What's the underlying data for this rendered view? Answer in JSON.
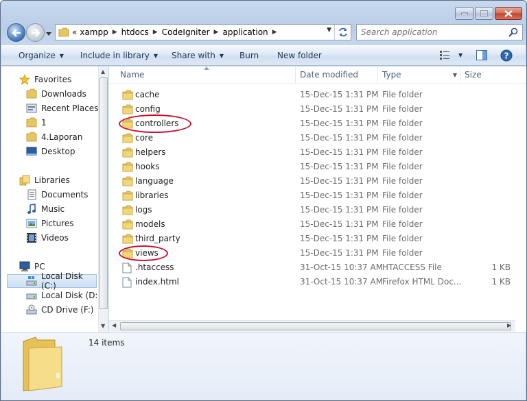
{
  "window": {
    "title": "application"
  },
  "address": {
    "overflow": "«",
    "crumbs": [
      "xampp",
      "htdocs",
      "CodeIgniter",
      "application"
    ]
  },
  "search": {
    "placeholder": "Search application"
  },
  "toolbar": {
    "organize": "Organize",
    "include_in_library": "Include in library",
    "share_with": "Share with",
    "burn": "Burn",
    "new_folder": "New folder"
  },
  "nav": {
    "favorites_header": "Favorites",
    "favorites": [
      "Downloads",
      "Recent Places",
      "1",
      "4.Laporan",
      "Desktop"
    ],
    "libraries_header": "Libraries",
    "libraries": [
      "Documents",
      "Music",
      "Pictures",
      "Videos"
    ],
    "computer_header": "PC",
    "drives": [
      "Local Disk (C:)",
      "Local Disk (D:)",
      "CD Drive (F:)"
    ],
    "selected": "Local Disk (C:)"
  },
  "columns": {
    "name": "Name",
    "date": "Date modified",
    "type": "Type",
    "size": "Size"
  },
  "files": [
    {
      "name": "cache",
      "date": "15-Dec-15 1:31 PM",
      "type": "File folder",
      "size": "",
      "kind": "folder"
    },
    {
      "name": "config",
      "date": "15-Dec-15 1:31 PM",
      "type": "File folder",
      "size": "",
      "kind": "folder"
    },
    {
      "name": "controllers",
      "date": "15-Dec-15 1:31 PM",
      "type": "File folder",
      "size": "",
      "kind": "folder"
    },
    {
      "name": "core",
      "date": "15-Dec-15 1:31 PM",
      "type": "File folder",
      "size": "",
      "kind": "folder"
    },
    {
      "name": "helpers",
      "date": "15-Dec-15 1:31 PM",
      "type": "File folder",
      "size": "",
      "kind": "folder"
    },
    {
      "name": "hooks",
      "date": "15-Dec-15 1:31 PM",
      "type": "File folder",
      "size": "",
      "kind": "folder"
    },
    {
      "name": "language",
      "date": "15-Dec-15 1:31 PM",
      "type": "File folder",
      "size": "",
      "kind": "folder"
    },
    {
      "name": "libraries",
      "date": "15-Dec-15 1:31 PM",
      "type": "File folder",
      "size": "",
      "kind": "folder"
    },
    {
      "name": "logs",
      "date": "15-Dec-15 1:31 PM",
      "type": "File folder",
      "size": "",
      "kind": "folder"
    },
    {
      "name": "models",
      "date": "15-Dec-15 1:31 PM",
      "type": "File folder",
      "size": "",
      "kind": "folder"
    },
    {
      "name": "third_party",
      "date": "15-Dec-15 1:31 PM",
      "type": "File folder",
      "size": "",
      "kind": "folder"
    },
    {
      "name": "views",
      "date": "15-Dec-15 1:31 PM",
      "type": "File folder",
      "size": "",
      "kind": "folder"
    },
    {
      "name": ".htaccess",
      "date": "31-Oct-15 10:37 AM",
      "type": "HTACCESS File",
      "size": "1 KB",
      "kind": "file"
    },
    {
      "name": "index.html",
      "date": "31-Oct-15 10:37 AM",
      "type": "Firefox HTML Doc...",
      "size": "1 KB",
      "kind": "file"
    }
  ],
  "highlighted": [
    "controllers",
    "views"
  ],
  "details": {
    "count": "14 items"
  },
  "colors": {
    "highlight": "#c8102e",
    "folder": "#f1d27a",
    "accent": "#2c67b1"
  }
}
